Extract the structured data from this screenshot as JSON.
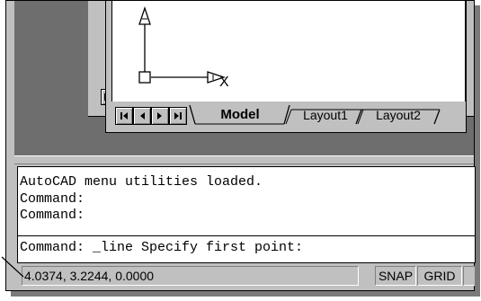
{
  "drawing": {
    "axis_x_label": "X"
  },
  "layout_tabs": [
    {
      "label": "Model",
      "active": true
    },
    {
      "label": "Layout1",
      "active": false
    },
    {
      "label": "Layout2",
      "active": false
    }
  ],
  "command_window": {
    "history": [
      "AutoCAD menu utilities loaded.",
      "Command:",
      "Command:"
    ],
    "prompt": "Command: _line Specify first point:"
  },
  "status_bar": {
    "coordinates": "4.0374,  3.2244, 0.0000",
    "snap_label": "SNAP",
    "grid_label": "GRID"
  },
  "icons": [
    "ucs-icon",
    "first-tab-icon",
    "prev-tab-icon",
    "next-tab-icon",
    "last-tab-icon",
    "scroll-left-icon"
  ],
  "colors": {
    "window_gray": "#c0c0c0",
    "workspace_gray": "#6e6e6e",
    "drawing_bg": "#ffffff"
  }
}
